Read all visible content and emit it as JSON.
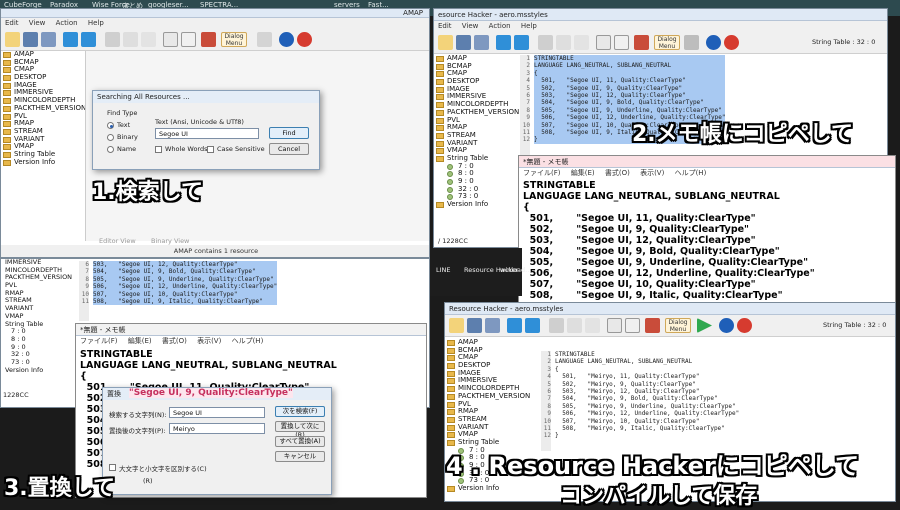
{
  "desktop": {
    "top_items": [
      "CubeForge",
      "Paradox",
      "Wise Force",
      "まとめ",
      "googleser...",
      "SPECTRA...",
      "servers",
      "Fast..."
    ],
    "top_sub": [
      "Launcher v2",
      "- ショート...",
      "Deleter",
      "",
      "DDR",
      "",
      "mods",
      "Launcher"
    ]
  },
  "app": {
    "title_left": "AMAP",
    "menu": [
      "Edit",
      "View",
      "Action",
      "Help"
    ],
    "dialog_menu_label": "Dialog Menu",
    "tree_items": [
      "AMAP",
      "BCMAP",
      "CMAP",
      "DESKTOP",
      "IMAGE",
      "IMMERSIVE",
      "MINCOLORDEPTH",
      "PACKTHEM_VERSION",
      "PVL",
      "RMAP",
      "STREAM",
      "VARIANT",
      "VMAP",
      "String Table",
      "Version Info"
    ],
    "tabs": [
      "Editor View",
      "Binary View"
    ],
    "status": "AMAP contains 1 resource"
  },
  "search_dialog": {
    "title": "Searching All Resources ...",
    "find_type_label": "Find Type",
    "text_field_label": "Text (Ansi, Unicode & UTf8)",
    "text_value": "Segoe UI",
    "options": [
      "Text",
      "Binary",
      "Name"
    ],
    "checks": [
      "Whole Words",
      "Case Sensitive"
    ],
    "find_button": "Find",
    "cancel_button": "Cancel"
  },
  "editor2": {
    "title": "esource Hacker - aero.msstyles",
    "status_right": "String Table : 32 : 0",
    "line_numbers": [
      "1",
      "2",
      "3",
      "4",
      "5",
      "6",
      "7",
      "8",
      "9",
      "10",
      "11",
      "12"
    ],
    "lines": [
      "STRINGTABLE",
      "LANGUAGE LANG_NEUTRAL, SUBLANG_NEUTRAL",
      "{",
      "  501,   \"Segoe UI, 11, Quality:ClearType\"",
      "  502,   \"Segoe UI, 9, Quality:ClearType\"",
      "  503,   \"Segoe UI, 12, Quality:ClearType\"",
      "  504,   \"Segoe UI, 9, Bold, Quality:ClearType\"",
      "  505,   \"Segoe UI, 9, Underline, Quality:ClearType\"",
      "  506,   \"Segoe UI, 12, Underline, Quality:ClearType\"",
      "  507,   \"Segoe UI, 10, Quality:ClearType\"",
      "  508,   \"Segoe UI, 9, Italic, Quality:ClearType\"",
      "}"
    ],
    "tree_children": [
      "7 : 0",
      "8 : 0",
      "9 : 0",
      "32 : 0",
      "73 : 0"
    ],
    "tree_tail": "Version Info",
    "bottom_status": "/ 1228CC"
  },
  "notepad1": {
    "title": "*無題 - メモ帳",
    "menu": [
      "ファイル(F)",
      "編集(E)",
      "書式(O)",
      "表示(V)",
      "ヘルプ(H)"
    ],
    "lines": [
      "STRINGTABLE",
      "LANGUAGE LANG_NEUTRAL, SUBLANG_NEUTRAL",
      "{",
      "  501,       \"Segoe UI, 11, Quality:ClearType\"",
      "  502,       \"Segoe UI, 9, Quality:ClearType\"",
      "  503,       \"Segoe UI, 12, Quality:ClearType\"",
      "  504,       \"Segoe UI, 9, Bold, Quality:ClearType\"",
      "  505,       \"Segoe UI, 9, Underline, Quality:ClearType\"",
      "  506,       \"Segoe UI, 12, Underline, Quality:ClearType\"",
      "  507,       \"Segoe UI, 10, Quality:ClearType\"",
      "  508,       \"Segoe UI, 9, Italic, Quality:ClearType\""
    ]
  },
  "left_lower": {
    "tree_items": [
      "IMMERSIVE",
      "MINCOLORDEPTH",
      "PACKTHEM_VERSION",
      "PVL",
      "RMAP",
      "STREAM",
      "VARIANT",
      "VMAP",
      "String Table",
      "7 : 0",
      "8 : 0",
      "9 : 0",
      "32 : 0",
      "73 : 0",
      "Version Info"
    ],
    "line_numbers": [
      "6",
      "7",
      "8",
      "9",
      "10",
      "11"
    ],
    "lines": [
      "503,   \"Segoe UI, 12, Quality:ClearType\"",
      "504,   \"Segoe UI, 9, Bold, Quality:ClearType\"",
      "505,   \"Segoe UI, 9, Underline, Quality:ClearType\"",
      "506,   \"Segoe UI, 12, Underline, Quality:ClearType\"",
      "507,   \"Segoe UI, 10, Quality:ClearType\"",
      "508,   \"Segoe UI, 9, Italic, Quality:ClearType\""
    ],
    "status": "1228CC"
  },
  "notepad2": {
    "title": "*無題 - メモ帳",
    "menu": [
      "ファイル(F)",
      "編集(E)",
      "書式(O)",
      "表示(V)",
      "ヘルプ(H)"
    ],
    "lines": [
      "STRINGTABLE",
      "LANGUAGE LANG_NEUTRAL, SUBLANG_NEUTRAL",
      "{",
      "  501,      \"Segoe UI, 11, Quality:ClearType\"",
      "  502",
      "  503",
      "  504",
      "  505",
      "  506",
      "  507",
      "  508"
    ]
  },
  "replace_dialog": {
    "title": "置換",
    "overlay_text": "\"Segoe UI, 9, Quality:ClearType\"",
    "find_label": "検索する文字列(N):",
    "find_value": "Segoe UI",
    "replace_label": "置換後の文字列(P):",
    "replace_value": "Meiryo",
    "buttons": [
      "次を検索(F)",
      "置換して次に(R)",
      "すべて置換(A)",
      "キャンセル"
    ],
    "check_label": "大文字と小文字を区別する(C)",
    "wrap_label": "(R)"
  },
  "taskbar_left": {
    "items": [
      "LINE",
      "Resource Hacker",
      "winload..."
    ]
  },
  "resource_hacker_final": {
    "title": "Resource Hacker - aero.msstyles",
    "status_right": "String Table : 32 : 0",
    "dialog_menu_label": "Dialog Menu",
    "tree_items": [
      "AMAP",
      "BCMAP",
      "CMAP",
      "DESKTOP",
      "IMAGE",
      "IMMERSIVE",
      "MINCOLORDEPTH",
      "PACKTHEM_VERSION",
      "PVL",
      "RMAP",
      "STREAM",
      "VARIANT",
      "VMAP",
      "String Table",
      "7 : 0",
      "8 : 0",
      "9 : 0",
      "32 : 0",
      "73 : 0",
      "Version Info"
    ],
    "line_numbers": [
      "1",
      "2",
      "3",
      "4",
      "5",
      "6",
      "7",
      "8",
      "9",
      "10",
      "11",
      "12"
    ],
    "lines": [
      "STRINGTABLE",
      "LANGUAGE LANG_NEUTRAL, SUBLANG_NEUTRAL",
      "{",
      "  501,   \"Meiryo, 11, Quality:ClearType\"",
      "  502,   \"Meiryo, 9, Quality:ClearType\"",
      "  503,   \"Meiryo, 12, Quality:ClearType\"",
      "  504,   \"Meiryo, 9, Bold, Quality:ClearType\"",
      "  505,   \"Meiryo, 9, Underline, Quality:ClearType\"",
      "  506,   \"Meiryo, 12, Underline, Quality:ClearType\"",
      "  507,   \"Meiryo, 10, Quality:ClearType\"",
      "  508,   \"Meiryo, 9, Italic, Quality:ClearType\"",
      "}"
    ]
  },
  "captions": {
    "step1": "1.検索して",
    "step2": "2.メモ帳にコピペして",
    "step3": "3.置換して",
    "step4_line1": "4 . Resource Hackerにコピペして",
    "step4_line2": "コンパイルして保存"
  },
  "colors": {
    "selection": "#a8c9f2",
    "folder": "#e8b84b",
    "compile_green": "#2fa84f",
    "stop_red": "#d63b2f",
    "info_blue": "#1f5fb8"
  }
}
